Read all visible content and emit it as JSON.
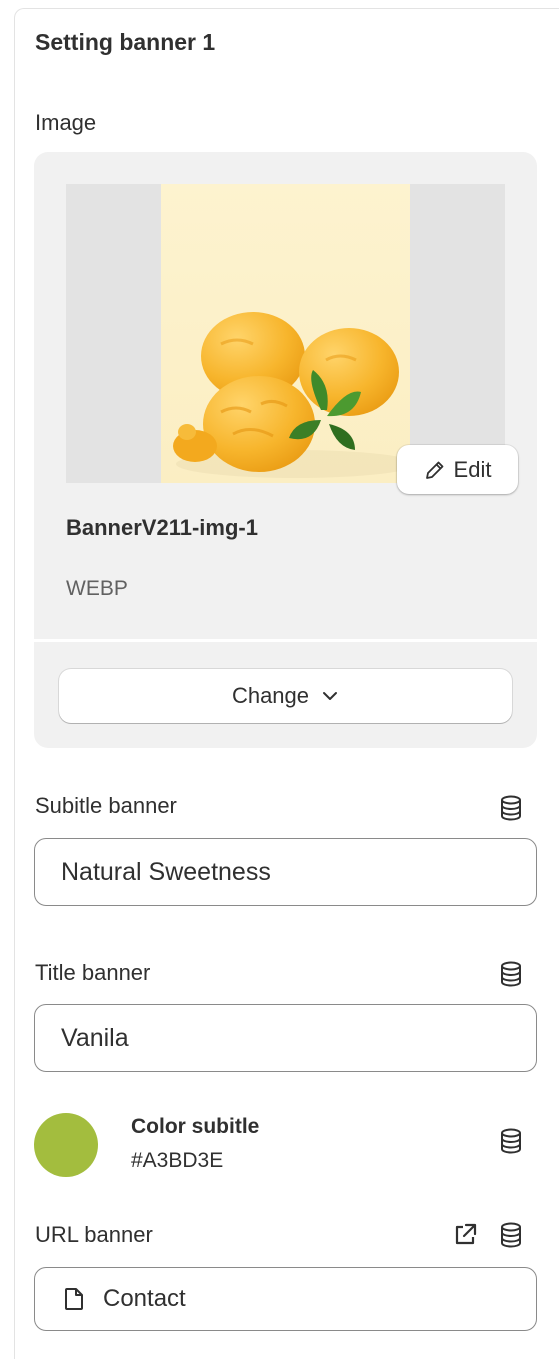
{
  "section": {
    "title": "Setting banner 1"
  },
  "image_field": {
    "label": "Image",
    "file_name": "BannerV211-img-1",
    "file_type": "WEBP",
    "edit_label": "Edit",
    "change_label": "Change"
  },
  "subtitle_field": {
    "label": "Subitle banner",
    "value": "Natural Sweetness"
  },
  "title_field": {
    "label": "Title banner",
    "value": "Vanila"
  },
  "color_field": {
    "label": "Color subitle",
    "value": "#A3BD3E",
    "swatch": "#A3BD3E"
  },
  "url_field": {
    "label": "URL banner",
    "value": "Contact"
  },
  "icons": {
    "dynamic_source": "database-icon",
    "edit": "pencil-icon",
    "change": "chevron-down-icon",
    "external": "external-link-icon",
    "page": "page-icon"
  }
}
